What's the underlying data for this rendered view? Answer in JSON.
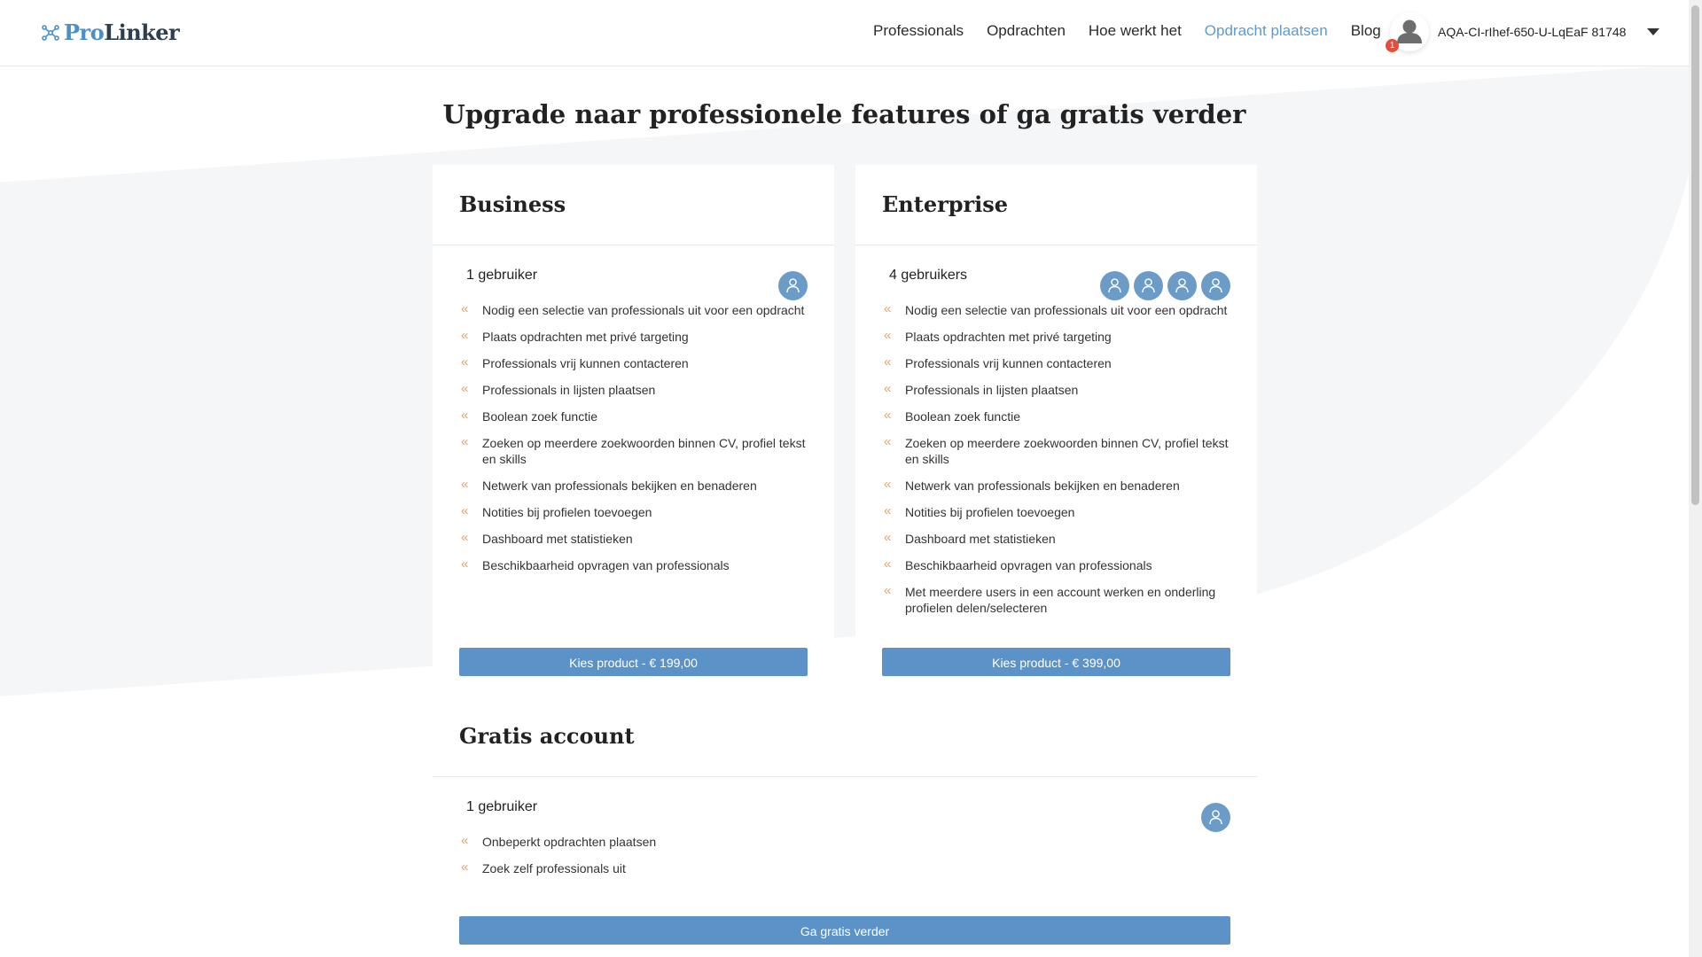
{
  "brand": {
    "pro": "Pro",
    "linker": "Linker"
  },
  "nav": [
    {
      "label": "Professionals",
      "active": false
    },
    {
      "label": "Opdrachten",
      "active": false
    },
    {
      "label": "Hoe werkt het",
      "active": false
    },
    {
      "label": "Opdracht plaatsen",
      "active": true
    },
    {
      "label": "Blog",
      "active": false
    }
  ],
  "user": {
    "name": "AQA-CI-rIhef-650-U-LqEaF 81748",
    "notifications": "1"
  },
  "page_title": "Upgrade naar professionele features of ga gratis verder",
  "plans": {
    "business": {
      "name": "Business",
      "users_label": "1 gebruiker",
      "user_icons": 1,
      "features": [
        "Nodig een selectie van professionals uit voor een opdracht",
        "Plaats opdrachten met privé targeting",
        "Professionals vrij kunnen contacteren",
        "Professionals in lijsten plaatsen",
        "Boolean zoek functie",
        "Zoeken op meerdere zoekwoorden binnen CV, profiel tekst en skills",
        "Netwerk van professionals bekijken en benaderen",
        "Notities bij profielen toevoegen",
        "Dashboard met statistieken",
        "Beschikbaarheid opvragen van professionals"
      ],
      "button": "Kies product - € 199,00"
    },
    "enterprise": {
      "name": "Enterprise",
      "users_label": "4 gebruikers",
      "user_icons": 4,
      "features": [
        "Nodig een selectie van professionals uit voor een opdracht",
        "Plaats opdrachten met privé targeting",
        "Professionals vrij kunnen contacteren",
        "Professionals in lijsten plaatsen",
        "Boolean zoek functie",
        "Zoeken op meerdere zoekwoorden binnen CV, profiel tekst en skills",
        "Netwerk van professionals bekijken en benaderen",
        "Notities bij profielen toevoegen",
        "Dashboard met statistieken",
        "Beschikbaarheid opvragen van professionals",
        "Met meerdere users in een account werken en onderling profielen delen/selecteren"
      ],
      "button": "Kies product - € 399,00"
    },
    "free": {
      "name": "Gratis account",
      "users_label": "1 gebruiker",
      "user_icons": 1,
      "features": [
        "Onbeperkt opdrachten plaatsen",
        "Zoek zelf professionals uit"
      ],
      "button": "Ga gratis verder"
    }
  },
  "icons": {
    "feature_bullet": "double-chevron-left-icon",
    "user": "user-icon",
    "avatar": "person-icon",
    "dropdown": "caret-down-icon"
  },
  "colors": {
    "accent": "#5b93c9",
    "nav_active": "#5b9bd5",
    "bullet": "#e8a267",
    "user_icon_bg": "#6b9cc8"
  }
}
